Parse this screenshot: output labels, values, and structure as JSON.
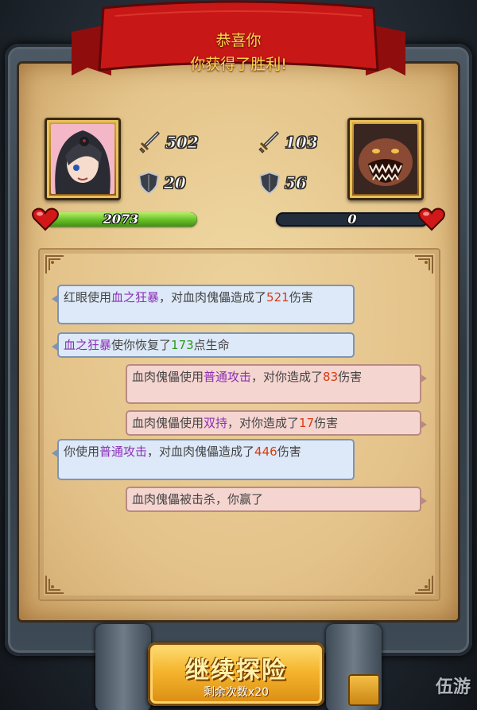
{
  "banner": {
    "line1": "恭喜你",
    "line2": "你获得了胜利!"
  },
  "player": {
    "attack": "502",
    "defense": "20",
    "hp_text": "2073",
    "hp_fraction": 1.0,
    "portrait_icon": "hero-portrait-icon"
  },
  "enemy": {
    "attack": "103",
    "defense": "56",
    "hp_text": "0",
    "hp_fraction": 0.0,
    "portrait_icon": "monster-portrait-icon"
  },
  "log": [
    {
      "side": "left",
      "parts": [
        {
          "t": "红眼使用"
        },
        {
          "t": "血之狂暴",
          "c": "hl"
        },
        {
          "t": "，对血肉傀儡造成了"
        },
        {
          "t": "521",
          "c": "num-r"
        },
        {
          "t": "伤害"
        }
      ]
    },
    {
      "side": "left",
      "parts": [
        {
          "t": "血之狂暴",
          "c": "hl"
        },
        {
          "t": "使你恢复了"
        },
        {
          "t": "173",
          "c": "num-g"
        },
        {
          "t": "点生命"
        }
      ]
    },
    {
      "side": "right",
      "parts": [
        {
          "t": "血肉傀儡使用"
        },
        {
          "t": "普通攻击",
          "c": "hl"
        },
        {
          "t": "，对你造成了"
        },
        {
          "t": "83",
          "c": "num-r"
        },
        {
          "t": "伤害"
        }
      ]
    },
    {
      "side": "right",
      "parts": [
        {
          "t": "血肉傀儡使用"
        },
        {
          "t": "双持",
          "c": "hl"
        },
        {
          "t": "，对你造成了"
        },
        {
          "t": "17",
          "c": "num-r"
        },
        {
          "t": "伤害"
        }
      ]
    },
    {
      "side": "left",
      "parts": [
        {
          "t": "你使用"
        },
        {
          "t": "普通攻击",
          "c": "hl"
        },
        {
          "t": "，对血肉傀儡造成了"
        },
        {
          "t": "446",
          "c": "num-r"
        },
        {
          "t": "伤害"
        }
      ]
    },
    {
      "side": "right",
      "parts": [
        {
          "t": "血肉傀儡被击杀，你赢了"
        }
      ]
    }
  ],
  "continue_button": {
    "label": "继续探险",
    "sub": "剩余次数x20"
  },
  "watermark": "伍游",
  "colors": {
    "highlight": "#8a2fb5",
    "damage": "#d93a10",
    "heal": "#2a9a1c",
    "hp_bar": "#6cc32a"
  }
}
